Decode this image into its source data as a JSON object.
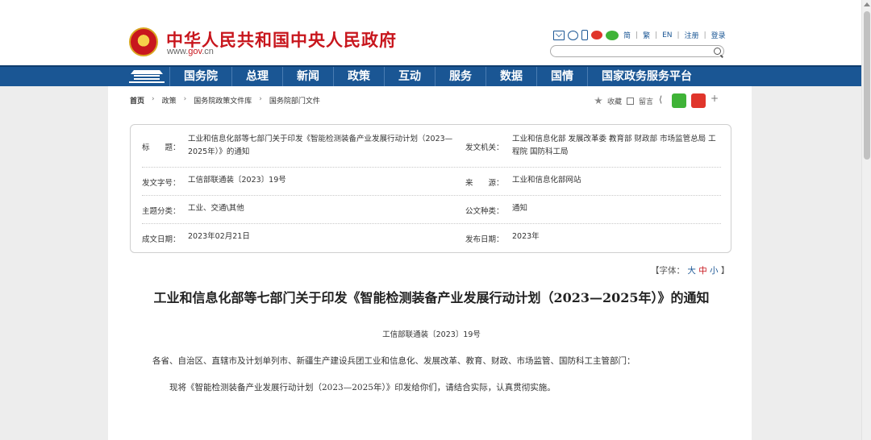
{
  "header": {
    "title": "中华人民共和国中央人民政府",
    "url_prefix": "www.",
    "url_gov": "gov",
    "url_suffix": ".cn",
    "links": [
      "简",
      "繁",
      "EN",
      "注册",
      "登录"
    ],
    "search_placeholder": ""
  },
  "nav": {
    "items": [
      "国务院",
      "总理",
      "新闻",
      "政策",
      "互动",
      "服务",
      "数据",
      "国情",
      "国家政务服务平台"
    ]
  },
  "breadcrumb": [
    "首页",
    "政策",
    "国务院政策文件库",
    "国务院部门文件"
  ],
  "share": {
    "collect": "收藏",
    "comment": "留言",
    "plus": "+"
  },
  "meta": {
    "title_key": "标　　题：",
    "title_val": "工业和信息化部等七部门关于印发《智能检测装备产业发展行动计划（2023—2025年）》的通知",
    "issuer_key": "发文机关：",
    "issuer_val": "工业和信息化部 发展改革委 教育部 财政部 市场监管总局 工程院 国防科工局",
    "docno_key": "发文字号：",
    "docno_val": "工信部联通装〔2023〕19号",
    "source_key": "来　　源：",
    "source_val": "工业和信息化部网站",
    "topic_key": "主题分类：",
    "topic_val": "工业、交通\\其他",
    "type_key": "公文种类：",
    "type_val": "通知",
    "written_key": "成文日期：",
    "written_val": "2023年02月21日",
    "published_key": "发布日期：",
    "published_val": "2023年"
  },
  "fontsize": {
    "label": "【字体：",
    "big": "大",
    "mid": "中",
    "small": "小",
    "close": "】"
  },
  "article": {
    "title": "工业和信息化部等七部门关于印发《智能检测装备产业发展行动计划（2023—2025年）》的通知",
    "doc_no": "工信部联通装〔2023〕19号",
    "para1": "各省、自治区、直辖市及计划单列市、新疆生产建设兵团工业和信息化、发展改革、教育、财政、市场监管、国防科工主管部门：",
    "para2": "现将《智能检测装备产业发展行动计划（2023—2025年）》印发给你们，请结合实际，认真贯彻实施。"
  }
}
